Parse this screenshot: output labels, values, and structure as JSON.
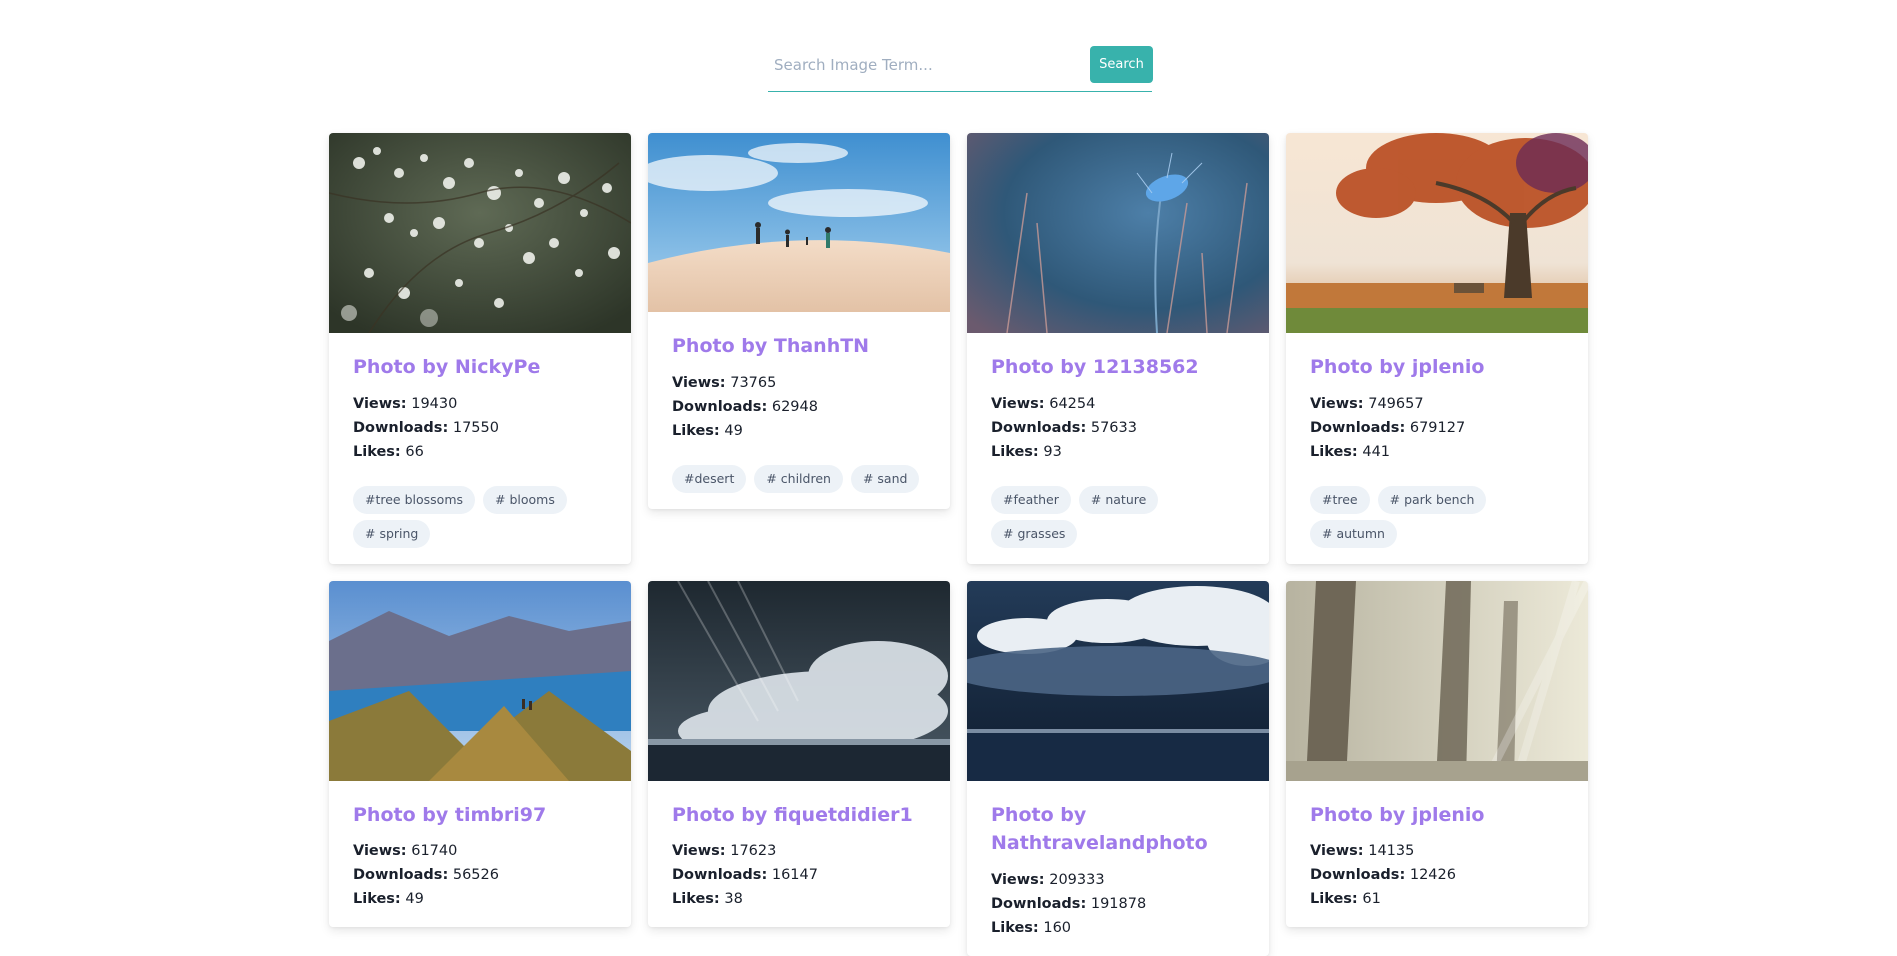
{
  "search": {
    "placeholder": "Search Image Term...",
    "value": "",
    "button_label": "Search"
  },
  "stat_labels": {
    "views": "Views:",
    "downloads": "Downloads:",
    "likes": "Likes:"
  },
  "cards": [
    {
      "title": "Photo by NickyPe",
      "views": "19430",
      "downloads": "17550",
      "likes": "66",
      "tags": [
        "#tree blossoms",
        "# blooms",
        "# spring"
      ],
      "image": "white tree blossoms on dark green branches"
    },
    {
      "title": "Photo by ThanhTN",
      "views": "73765",
      "downloads": "62948",
      "likes": "49",
      "tags": [
        "#desert",
        "# children",
        "# sand"
      ],
      "image": "children running on sand dune under blue sky"
    },
    {
      "title": "Photo by 12138562",
      "views": "64254",
      "downloads": "57633",
      "likes": "93",
      "tags": [
        "#feather",
        "# nature",
        "# grasses"
      ],
      "image": "blue feather on dry grass stems"
    },
    {
      "title": "Photo by jplenio",
      "views": "749657",
      "downloads": "679127",
      "likes": "441",
      "tags": [
        "#tree",
        "# park bench",
        "# autumn"
      ],
      "image": "autumn tree with bench in misty field"
    },
    {
      "title": "Photo by timbri97",
      "views": "61740",
      "downloads": "56526",
      "likes": "49",
      "tags": [],
      "image": "mountain ridge above blue lake"
    },
    {
      "title": "Photo by fiquetdidier1",
      "views": "17623",
      "downloads": "16147",
      "likes": "38",
      "tags": [],
      "image": "large ocean wave crashing under stormy sky"
    },
    {
      "title": "Photo by Nathtravelandphoto",
      "views": "209333",
      "downloads": "191878",
      "likes": "160",
      "tags": [],
      "image": "dramatic clouds over dark sea"
    },
    {
      "title": "Photo by jplenio",
      "views": "14135",
      "downloads": "12426",
      "likes": "61",
      "tags": [],
      "image": "foggy forest with tree trunks"
    }
  ],
  "colors": {
    "accent": "#38b2ac",
    "title": "#9f7aea",
    "tag_bg": "#edf2f7"
  }
}
